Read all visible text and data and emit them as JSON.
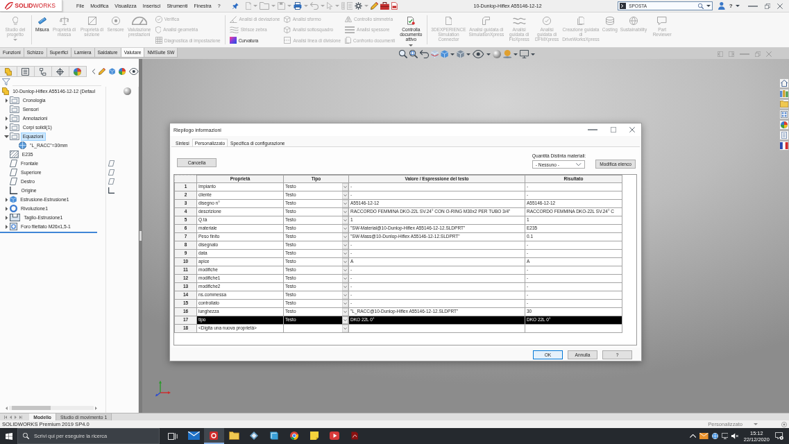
{
  "app_bar": {
    "logo": "**SOLID**WORKS",
    "menu": [
      "File",
      "Modifica",
      "Visualizza",
      "Inserisci",
      "Strumenti",
      "Finestra",
      "?"
    ],
    "title": "10-Dunlop-Hiflex A55146-12-12",
    "search": {
      "value": "SPOSTA"
    },
    "help": "?"
  },
  "ribbon": {
    "groups": [
      {
        "items": [
          {
            "kind": "large",
            "label": "Studio del progetto",
            "disabled": true,
            "dropdown": true
          }
        ]
      },
      {
        "items": [
          {
            "kind": "large",
            "label": "Misura",
            "disabled": false
          },
          {
            "kind": "large",
            "label": "Proprietà di massa",
            "disabled": true
          },
          {
            "kind": "large",
            "label": "Proprietà di sezione",
            "disabled": true
          },
          {
            "kind": "large",
            "label": "Sensore",
            "disabled": true
          },
          {
            "kind": "large",
            "label": "Valutazione prestazioni",
            "disabled": true
          },
          {
            "kind": "stack",
            "items": [
              {
                "label": "Verifica",
                "disabled": true
              },
              {
                "label": "Analisi geometria",
                "disabled": true
              },
              {
                "label": "Diagnostica di impostazione",
                "disabled": true
              }
            ]
          }
        ]
      },
      {
        "items": [
          {
            "kind": "stack",
            "items": [
              {
                "label": "Analisi di deviazione",
                "disabled": true
              },
              {
                "label": "Strisce zebra",
                "disabled": true
              },
              {
                "label": "Curvatura",
                "disabled": false
              }
            ]
          },
          {
            "kind": "stack",
            "items": [
              {
                "label": "Analisi sformo",
                "disabled": true
              },
              {
                "label": "Analisi sottosquadro",
                "disabled": true
              },
              {
                "label": "Analisi linea di divisione",
                "disabled": true
              }
            ]
          },
          {
            "kind": "stack",
            "items": [
              {
                "label": "Controllo simmetria",
                "disabled": true
              },
              {
                "label": "Analisi spessore",
                "disabled": true
              },
              {
                "label": "Confronto documenti",
                "disabled": true
              }
            ]
          },
          {
            "kind": "large",
            "label": "Controlla documento attivo",
            "disabled": false,
            "dropdown": true
          }
        ]
      },
      {
        "items": [
          {
            "kind": "large",
            "label": "3DEXPERIENCE Simulation Connector",
            "disabled": true
          },
          {
            "kind": "large",
            "label": "Analisi guidata di SimulationXpress",
            "disabled": true
          },
          {
            "kind": "large",
            "label": "Analisi guidata di FloXpress",
            "disabled": true
          },
          {
            "kind": "large",
            "label": "Analisi guidata di DFMXpress",
            "disabled": true
          },
          {
            "kind": "large",
            "label": "Creazione guidata di DriveWorksXpress",
            "disabled": true
          },
          {
            "kind": "large",
            "label": "Costing",
            "disabled": true
          },
          {
            "kind": "large",
            "label": "Sustainability",
            "disabled": true
          },
          {
            "kind": "large",
            "label": "Part Reviewer",
            "disabled": true
          }
        ]
      }
    ]
  },
  "command_tabs": [
    {
      "label": "Funzioni",
      "selected": false
    },
    {
      "label": "Schizzo",
      "selected": false
    },
    {
      "label": "Superfici",
      "selected": false
    },
    {
      "label": "Lamiera",
      "selected": false
    },
    {
      "label": "Saldature",
      "selected": false
    },
    {
      "label": "Valutare",
      "selected": true
    },
    {
      "label": "NMSuite SW",
      "selected": false
    }
  ],
  "feature_tree": {
    "items": [
      {
        "label": "10-Dunlop-Hiflex A55146-12-12 (Defaul",
        "kind": "part",
        "selected": false,
        "children": [
          {
            "label": "Cronologia",
            "kind": "folder",
            "expanded": false,
            "selected": false
          },
          {
            "label": "Sensori",
            "kind": "folder",
            "selected": false
          },
          {
            "label": "Annotazioni",
            "kind": "folder",
            "expanded": false,
            "selected": false
          },
          {
            "label": "Corpi solidi(1)",
            "kind": "folder",
            "expanded": false,
            "selected": false
          },
          {
            "label": "Equazioni",
            "kind": "folder",
            "expanded": true,
            "selected": true,
            "children": [
              {
                "label": "\"L_RACC\"=30mm",
                "kind": "equation",
                "selected": false
              }
            ]
          },
          {
            "label": "E235",
            "kind": "material",
            "selected": false
          },
          {
            "label": "Frontale",
            "kind": "plane",
            "selected": false
          },
          {
            "label": "Superiore",
            "kind": "plane",
            "selected": false
          },
          {
            "label": "Destro",
            "kind": "plane",
            "selected": false
          },
          {
            "label": "Origine",
            "kind": "origin",
            "selected": false
          },
          {
            "label": "Estrusione-Estrusione1",
            "kind": "extrude",
            "expanded": false,
            "selected": false
          },
          {
            "label": "Rivoluzione1",
            "kind": "revolve",
            "expanded": false,
            "selected": false
          },
          {
            "label": "Taglio-Estrusione1",
            "kind": "cut",
            "expanded": false,
            "selected": false
          },
          {
            "label": "Foro filettato M26x1,5-1",
            "kind": "hole",
            "expanded": false,
            "selected": false
          }
        ]
      }
    ]
  },
  "dialog": {
    "title": "Riepilogo informazioni",
    "tabs": [
      {
        "label": "Sintesi",
        "selected": false
      },
      {
        "label": "Personalizzato",
        "selected": true
      },
      {
        "label": "Specifica di configurazione",
        "selected": false
      }
    ],
    "delete_button": "Cancella",
    "bom_quantity": {
      "label": "Quantità Distinta materiali:",
      "value": "- Nessuno -"
    },
    "edit_list_button": "Modifica elenco",
    "table": {
      "columns": [
        "Proprietà",
        "Tipo",
        "Valore / Espressione del testo",
        "Risultato"
      ],
      "rows": [
        {
          "number": "1",
          "property": "Impianto",
          "type": "Testo",
          "value": "-",
          "result": "-",
          "selected": false
        },
        {
          "number": "2",
          "property": "cliente",
          "type": "Testo",
          "value": "-",
          "result": "-",
          "selected": false
        },
        {
          "number": "3",
          "property": "disegno n°",
          "type": "Testo",
          "value": "A55146-12-12",
          "result": "A55146-12-12",
          "selected": false
        },
        {
          "number": "4",
          "property": "descrizione",
          "type": "Testo",
          "value": "RACCORDO FEMMINA DKO-22L SV.24° CON O-RING M30x2 PER TUBO 3/4\"",
          "result": "RACCORDO FEMMINA DKO-22L SV.24° C",
          "selected": false
        },
        {
          "number": "5",
          "property": "Q.tà",
          "type": "Testo",
          "value": "1",
          "result": "1",
          "selected": false
        },
        {
          "number": "6",
          "property": "materiale",
          "type": "Testo",
          "value": "\"SW-Material@10-Dunlop-Hiflex A55146-12-12.SLDPRT\"",
          "result": "E235",
          "selected": false
        },
        {
          "number": "7",
          "property": "Peso finito",
          "type": "Testo",
          "value": "\"SW-Mass@10-Dunlop-Hiflex A55146-12-12.SLDPRT\"",
          "result": "0.1",
          "selected": false
        },
        {
          "number": "8",
          "property": "disegnato",
          "type": "Testo",
          "value": "-",
          "result": "-",
          "selected": false
        },
        {
          "number": "9",
          "property": "data",
          "type": "Testo",
          "value": "-",
          "result": "-",
          "selected": false
        },
        {
          "number": "10",
          "property": "apice",
          "type": "Testo",
          "value": "A",
          "result": "A",
          "selected": false
        },
        {
          "number": "11",
          "property": "modifiche",
          "type": "Testo",
          "value": "-",
          "result": "-",
          "selected": false
        },
        {
          "number": "12",
          "property": "modifiche1",
          "type": "Testo",
          "value": "-",
          "result": "-",
          "selected": false
        },
        {
          "number": "13",
          "property": "modifiche2",
          "type": "Testo",
          "value": "-",
          "result": "-",
          "selected": false
        },
        {
          "number": "14",
          "property": "ns.commessa",
          "type": "Testo",
          "value": "-",
          "result": "-",
          "selected": false
        },
        {
          "number": "15",
          "property": "controllato",
          "type": "Testo",
          "value": "-",
          "result": "-",
          "selected": false
        },
        {
          "number": "16",
          "property": "lunghezza",
          "type": "Testo",
          "value": "\"L_RACC@10-Dunlop-Hiflex A55146-12-12.SLDPRT\"",
          "result": "30",
          "selected": false
        },
        {
          "number": "17",
          "property": "tipo",
          "type": "Testo",
          "value": "DKO 22L 0°",
          "result": "DKO 22L 0°",
          "selected": true
        },
        {
          "number": "18",
          "property": "<Digita una nuova proprietà>",
          "selected": false
        }
      ]
    },
    "buttons": [
      {
        "label": "OK",
        "focused": true
      },
      {
        "label": "Annulla",
        "focused": false
      },
      {
        "label": "?",
        "focused": false
      }
    ]
  },
  "bottom_tabs": [
    {
      "label": "Modello",
      "selected": true
    },
    {
      "label": "Studio di movimento 1",
      "selected": false
    }
  ],
  "status_bar": {
    "version": "SOLIDWORKS Premium 2019 SP4.0",
    "configuration": "Personalizzato"
  },
  "taskbar": {
    "search": {
      "placeholder": "Scrivi qui per eseguire la ricerca"
    },
    "apps": [
      {
        "selected": false
      },
      {
        "selected": true
      },
      {
        "selected": false
      },
      {
        "selected": false
      },
      {
        "selected": false
      },
      {
        "selected": false
      },
      {
        "selected": false
      },
      {
        "selected": false
      },
      {
        "selected": false
      }
    ],
    "time": "15:12",
    "date": "22/12/2020"
  }
}
